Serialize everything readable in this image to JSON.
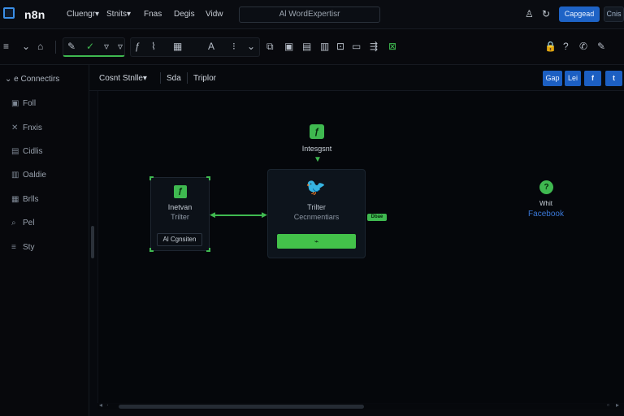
{
  "app": {
    "name": "n8n",
    "nav": [
      "Cluengr▾",
      "Stnits▾",
      "Fnas",
      "Degis",
      "Vidw"
    ],
    "search_text": "Al WordExpertisr",
    "primary_button": "Capgead",
    "secondary_button": "Cnis"
  },
  "toolbar": {
    "icons_left": [
      "≡",
      "⌄",
      "⌂"
    ],
    "group_green": [
      "✎",
      "✓",
      "▿"
    ],
    "group_mid": [
      "ƒ",
      "⌇",
      "▦",
      "A",
      "⁝",
      "⌄"
    ],
    "icons_right": [
      "⧉",
      "▣",
      "▤",
      "▥",
      "⊡",
      "⇶",
      "⊠"
    ],
    "icons_far": [
      "🔒",
      "?",
      "✆",
      "✎"
    ]
  },
  "sidebar": {
    "title": "e Connectirs",
    "items": [
      {
        "icon": "▣",
        "label": "Foll"
      },
      {
        "icon": "✕",
        "label": "Fnxis"
      },
      {
        "icon": "▤",
        "label": "Cidlis"
      },
      {
        "icon": "▥",
        "label": "Oaldie"
      },
      {
        "icon": "▦",
        "label": "Brlls"
      },
      {
        "icon": "⌕",
        "label": "Pel"
      },
      {
        "icon": "≡",
        "label": "Sty"
      }
    ]
  },
  "canvas_header": {
    "title": "Cosnt Stnlle▾",
    "tab1": "Sda",
    "tab2": "Triplor",
    "buttons": [
      "Gap",
      "Lei",
      "f",
      "t"
    ]
  },
  "workflow": {
    "trigger": {
      "icon": "ƒ",
      "label": "Intesgsnt"
    },
    "left_node": {
      "icon": "ƒ",
      "line1": "Inetvan",
      "line2": "Trilter",
      "tag": "Al Cgnsiten"
    },
    "main_node": {
      "icon": "🐦",
      "line1": "Trilter",
      "line2": "Cecnmentiars",
      "bar": "⌁",
      "badge": "Dbae"
    },
    "right_node": {
      "icon": "?",
      "line1": "Whit",
      "line2": "Facebook"
    }
  },
  "colors": {
    "accent_green": "#3fb950",
    "primary_blue": "#1e63c6",
    "background": "#05070b"
  }
}
